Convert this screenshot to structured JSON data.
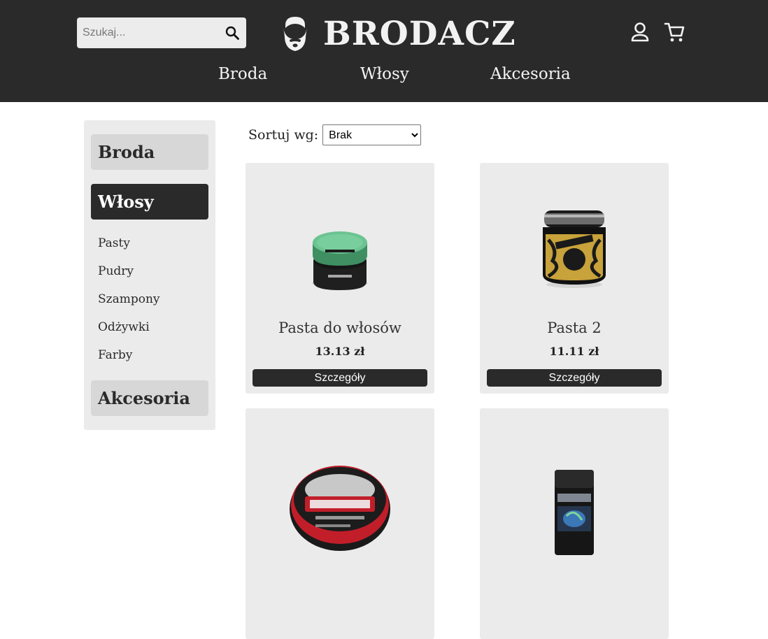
{
  "header": {
    "search": {
      "placeholder": "Szukaj...",
      "icon": "search-icon"
    },
    "brand": "BRODACZ",
    "logo_icon": "bearded-face-icon",
    "account_icon": "user-icon",
    "cart_icon": "shopping-cart-icon",
    "nav": [
      {
        "label": "Broda"
      },
      {
        "label": "Włosy"
      },
      {
        "label": "Akcesoria"
      }
    ]
  },
  "sidebar": {
    "categories": [
      {
        "label": "Broda",
        "active": false
      },
      {
        "label": "Włosy",
        "active": true
      },
      {
        "label": "Akcesoria",
        "active": false
      }
    ],
    "subcategories": [
      {
        "label": "Pasty"
      },
      {
        "label": "Pudry"
      },
      {
        "label": "Szampony"
      },
      {
        "label": "Odżywki"
      },
      {
        "label": "Farby"
      }
    ]
  },
  "sort": {
    "label": "Sortuj wg:",
    "selected": "Brak"
  },
  "products": [
    {
      "name": "Pasta do włosów",
      "price": "13.13 zł",
      "button": "Szczegóły",
      "image": "papillon-pomade-jar"
    },
    {
      "name": "Pasta 2",
      "price": "11.11 zł",
      "button": "Szczegóły",
      "image": "butter-pomade-jar"
    },
    {
      "name": "",
      "price": "",
      "button": "",
      "image": "uppercut-deluxe-pomade-tin"
    },
    {
      "name": "",
      "price": "",
      "button": "",
      "image": "hair-styling-powder-bottle"
    }
  ],
  "colors": {
    "header_bg": "#2a2a2a",
    "panel_bg": "#ebebeb",
    "category_bg": "#d7d7d7",
    "active_bg": "#2a2a2a",
    "button_bg": "#2a2a2a"
  }
}
